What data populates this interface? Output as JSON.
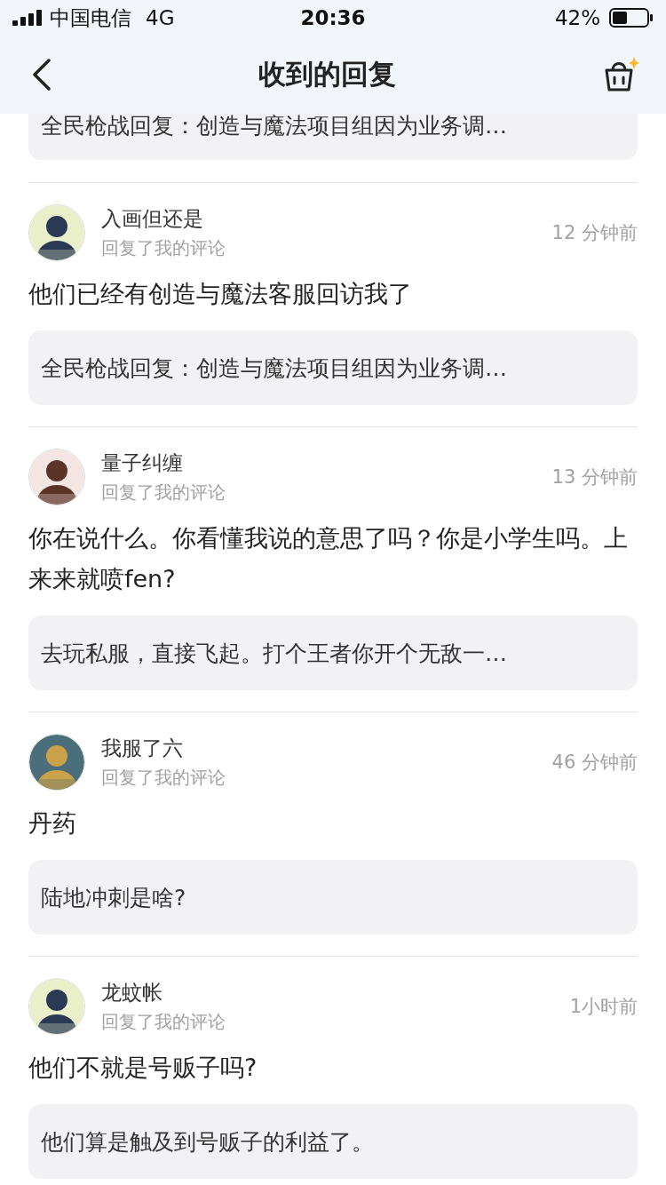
{
  "status_bar": {
    "carrier": "中国电信",
    "network": "4G",
    "time": "20:36",
    "battery": "42%"
  },
  "nav": {
    "title": "收到的回复"
  },
  "partial_quote": "全民枪战回复：创造与魔法项目组因为业务调…",
  "replies": [
    {
      "name": "入画但还是",
      "action": "回复了我的评论",
      "time": "12 分钟前",
      "text": "他们已经有创造与魔法客服回访我了",
      "quote": "全民枪战回复：创造与魔法项目组因为业务调…"
    },
    {
      "name": "量子纠缠",
      "action": "回复了我的评论",
      "time": "13 分钟前",
      "text": "你在说什么。你看懂我说的意思了吗？你是小学生吗。上来来就喷fen?",
      "quote": "去玩私服，直接飞起。打个王者你开个无敌一…"
    },
    {
      "name": "我服了六",
      "action": "回复了我的评论",
      "time": "46 分钟前",
      "text": "丹药",
      "quote": "陆地冲刺是啥?"
    },
    {
      "name": "龙蚊帐",
      "action": "回复了我的评论",
      "time": "1小时前",
      "text": "他们不就是号贩子吗?",
      "quote": "他们算是触及到号贩子的利益了。"
    }
  ]
}
